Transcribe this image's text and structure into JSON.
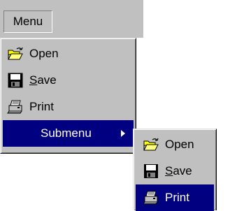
{
  "menubar": {
    "title": "Menu"
  },
  "main_menu": {
    "items": [
      {
        "label": "Open",
        "icon": "open-folder-icon"
      },
      {
        "label": "Save",
        "icon": "floppy-disk-icon",
        "mnemonic": "S"
      },
      {
        "label": "Print",
        "icon": "printer-icon"
      },
      {
        "label": "Submenu",
        "has_submenu": true,
        "highlighted": true
      }
    ]
  },
  "submenu": {
    "items": [
      {
        "label": "Open",
        "icon": "open-folder-icon"
      },
      {
        "label": "Save",
        "icon": "floppy-disk-icon",
        "mnemonic": "S"
      },
      {
        "label": "Print",
        "icon": "printer-icon",
        "highlighted": true
      }
    ]
  },
  "colors": {
    "face": "#c0c0c0",
    "highlight": "#000080",
    "highlight_text": "#ffffff"
  }
}
